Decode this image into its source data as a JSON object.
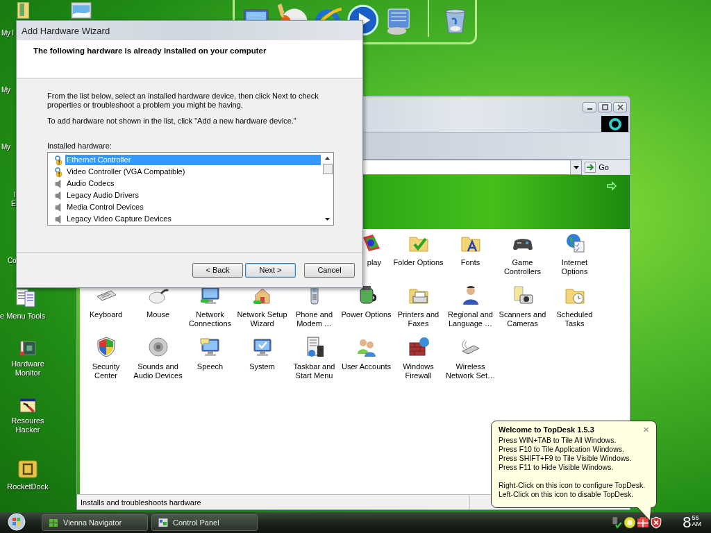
{
  "desktop": {
    "partial_labels": [
      {
        "lines": [
          "My I"
        ]
      },
      {
        "lines": [
          "My"
        ]
      },
      {
        "lines": [
          "My"
        ]
      },
      {
        "lines": [
          "I",
          "E"
        ]
      },
      {
        "lines": [
          "Co"
        ]
      }
    ],
    "icons": [
      {
        "label": "e Menu Tools"
      },
      {
        "label": "Hardware Monitor"
      },
      {
        "label": "Resoures Hacker"
      },
      {
        "label": "RocketDock"
      }
    ]
  },
  "wizard": {
    "title": "Add Hardware Wizard",
    "heading": "The following hardware is already installed on your computer",
    "paragraphs": [
      "From the list below, select an installed hardware device, then click Next to check properties or troubleshoot a problem you might be having.",
      "To add hardware not shown in the list, click \"Add a new hardware device.\""
    ],
    "list_label": "Installed hardware:",
    "items": [
      {
        "label": "Ethernet Controller",
        "kind": "warning",
        "selected": true
      },
      {
        "label": "Video Controller (VGA Compatible)",
        "kind": "warning",
        "selected": false
      },
      {
        "label": "Audio Codecs",
        "kind": "sound",
        "selected": false
      },
      {
        "label": "Legacy Audio Drivers",
        "kind": "sound",
        "selected": false
      },
      {
        "label": "Media Control Devices",
        "kind": "sound",
        "selected": false
      },
      {
        "label": "Legacy Video Capture Devices",
        "kind": "sound",
        "selected": false
      }
    ],
    "buttons": [
      {
        "label": "< Back",
        "default": false
      },
      {
        "label": "Next >",
        "default": true
      },
      {
        "label": "Cancel",
        "default": false
      }
    ]
  },
  "control_panel": {
    "go_label": "Go",
    "rows": [
      [
        {},
        {},
        {},
        {},
        {},
        {
          "label": "play"
        },
        {
          "label": "Folder Options"
        },
        {
          "label": "Fonts"
        },
        {
          "label": "Game Controllers"
        },
        {
          "label": "Internet Options"
        }
      ],
      [
        {
          "label": "Keyboard"
        },
        {
          "label": "Mouse"
        },
        {
          "label": "Network Connections"
        },
        {
          "label": "Network Setup Wizard"
        },
        {
          "label": "Phone and Modem …"
        },
        {
          "label": "Power Options"
        },
        {
          "label": "Printers and Faxes"
        },
        {
          "label": "Regional and Language …"
        },
        {
          "label": "Scanners and Cameras"
        },
        {
          "label": "Scheduled Tasks"
        }
      ],
      [
        {
          "label": "Security Center"
        },
        {
          "label": "Sounds and Audio Devices"
        },
        {
          "label": "Speech"
        },
        {
          "label": "System"
        },
        {
          "label": "Taskbar and Start Menu"
        },
        {
          "label": "User Accounts"
        },
        {
          "label": "Windows Firewall"
        },
        {
          "label": "Wireless Network Set…"
        }
      ]
    ],
    "status": "Installs and troubleshoots hardware"
  },
  "balloon": {
    "title": "Welcome to TopDesk 1.5.3",
    "close": "×",
    "paragraphs": [
      [
        "Press WIN+TAB to Tile All Windows.",
        "Press F10 to Tile Application Windows.",
        "Press SHIFT+F9 to Tile Visible Windows.",
        "Press F11 to Hide Visible Windows."
      ],
      [
        "Right-Click on this icon to configure TopDesk.",
        "Left-Click on this icon to disable TopDesk."
      ]
    ]
  },
  "taskbar": {
    "buttons": [
      {
        "label": "Vienna Navigator",
        "selected": false
      },
      {
        "label": "Control Panel",
        "selected": false
      }
    ],
    "clock": {
      "hour": "8",
      "minute": "56",
      "ampm": "AM"
    }
  }
}
